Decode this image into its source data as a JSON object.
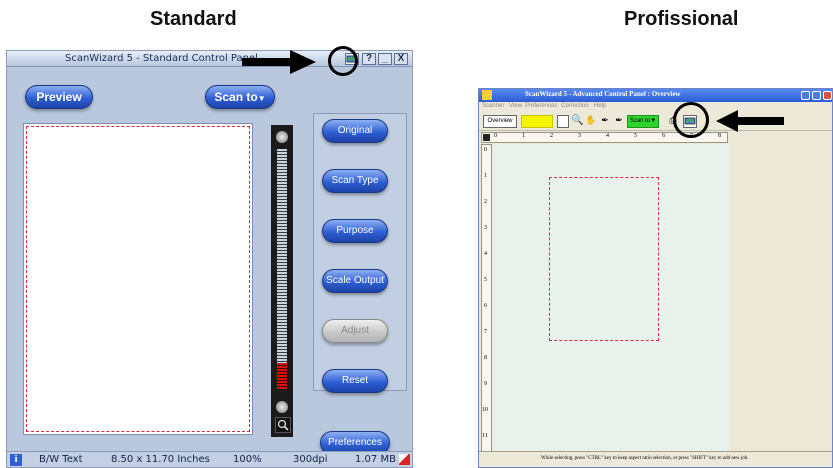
{
  "headings": {
    "standard": "Standard",
    "professional": "Profissional"
  },
  "standard": {
    "title": "ScanWizard 5 - Standard Control Panel",
    "title_buttons": {
      "help": "?",
      "minimize": "_",
      "close": "X"
    },
    "preview_label": "Preview",
    "scan_to_label": "Scan to",
    "side_buttons": [
      "Original",
      "Scan Type",
      "Purpose",
      "Scale Output",
      "Adjust",
      "Reset"
    ],
    "preferences_label": "Preferences",
    "status": {
      "info": "i",
      "type": "B/W Text",
      "size": "8.50 x 11.70 Inches",
      "zoom": "100%",
      "dpi": "300dpi",
      "file_size": "1.07 MB"
    }
  },
  "professional": {
    "title": "ScanWizard 5 - Advanced Control Panel : Overview",
    "menu": [
      "Scanner",
      "View",
      "Preferences",
      "Correction",
      "Help"
    ],
    "overview_label": "Overview",
    "scan_to_label": "Scan to",
    "ruler_numbers": [
      "0",
      "1",
      "2",
      "3",
      "4",
      "5",
      "6",
      "7",
      "8"
    ],
    "vruler_numbers": [
      "0",
      "1",
      "2",
      "3",
      "4",
      "5",
      "6",
      "7",
      "8",
      "9",
      "10",
      "11"
    ],
    "status_text": "While selecting, press \"CTRL\" key to keep aspect ratio selection, or press \"SHIFT\" key to add new job."
  },
  "colors": {
    "accent_blue": "#2f5fd4",
    "selection_red": "#d02a3c",
    "highlight_yellow": "#f4f400",
    "scan_green": "#2fd42f"
  }
}
